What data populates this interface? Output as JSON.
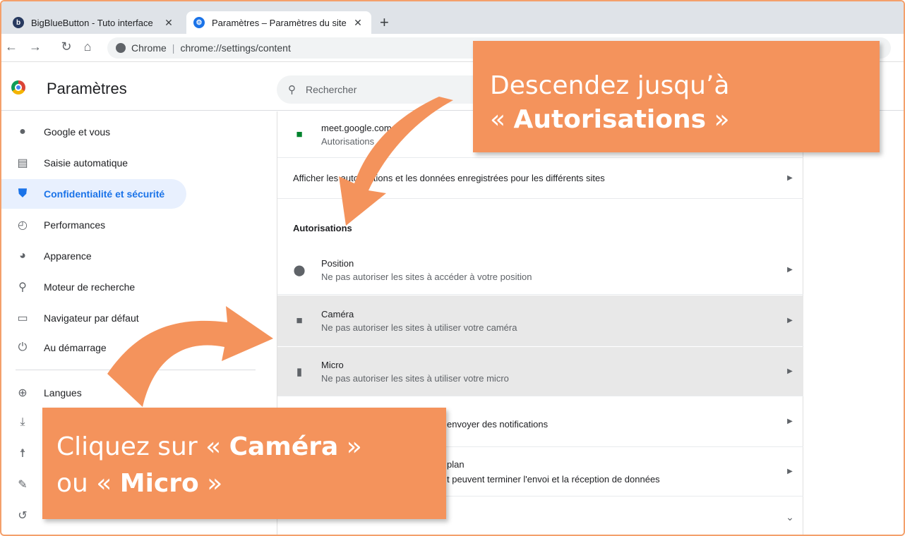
{
  "tabs": [
    {
      "title": "BigBlueButton - Tuto interface",
      "close": "✕",
      "icon": "bigbluebutton-icon",
      "active": false
    },
    {
      "title": "Paramètres – Paramètres du site",
      "close": "✕",
      "icon": "gear-icon",
      "active": true
    }
  ],
  "new_tab": "+",
  "omnibox": {
    "site": "Chrome",
    "url": "chrome://settings/content"
  },
  "header": {
    "title": "Paramètres",
    "search_placeholder": "Rechercher"
  },
  "sidebar": {
    "items": [
      {
        "label": "Google et vous",
        "icon": "person-icon"
      },
      {
        "label": "Saisie automatique",
        "icon": "clipboard-icon"
      },
      {
        "label": "Confidentialité et sécurité",
        "icon": "shield-icon",
        "active": true
      },
      {
        "label": "Performances",
        "icon": "gauge-icon"
      },
      {
        "label": "Apparence",
        "icon": "palette-icon"
      },
      {
        "label": "Moteur de recherche",
        "icon": "search-icon"
      },
      {
        "label": "Navigateur par défaut",
        "icon": "browser-icon"
      },
      {
        "label": "Au démarrage",
        "icon": "power-icon"
      },
      {
        "label": "Langues",
        "icon": "globe-icon"
      }
    ]
  },
  "content": {
    "site_row": {
      "title": "meet.google.com",
      "subtitle": "Autorisations"
    },
    "show_all": "Afficher les autorisations et les données enregistrées pour les différents sites",
    "section": "Autorisations",
    "permissions": [
      {
        "title": "Position",
        "subtitle": "Ne pas autoriser les sites à accéder à votre position",
        "icon": "location-pin-icon"
      },
      {
        "title": "Caméra",
        "subtitle": "Ne pas autoriser les sites à utiliser votre caméra",
        "icon": "camera-icon",
        "highlight": true
      },
      {
        "title": "Micro",
        "subtitle": "Ne pas autoriser les sites à utiliser votre micro",
        "icon": "microphone-icon",
        "highlight": true
      },
      {
        "title": "",
        "subtitle": "envoyer des notifications",
        "icon": "bell-icon"
      },
      {
        "title": "plan",
        "subtitle": "t peuvent terminer l'envoi et la réception de données",
        "icon": "sync-icon"
      }
    ]
  },
  "callouts": {
    "top_line1": "Descendez jusqu’à",
    "top_open": "« ",
    "top_bold": "Autorisations",
    "top_close": " »",
    "bottom_pre": "Cliquez sur « ",
    "bottom_bold1": "Caméra",
    "bottom_mid": " »",
    "bottom_pre2": "ou « ",
    "bottom_bold2": "Micro",
    "bottom_close": " »"
  },
  "colors": {
    "accent": "#1a73e8",
    "callout": "#f4935c",
    "highlight_row": "#e8e8e8"
  }
}
